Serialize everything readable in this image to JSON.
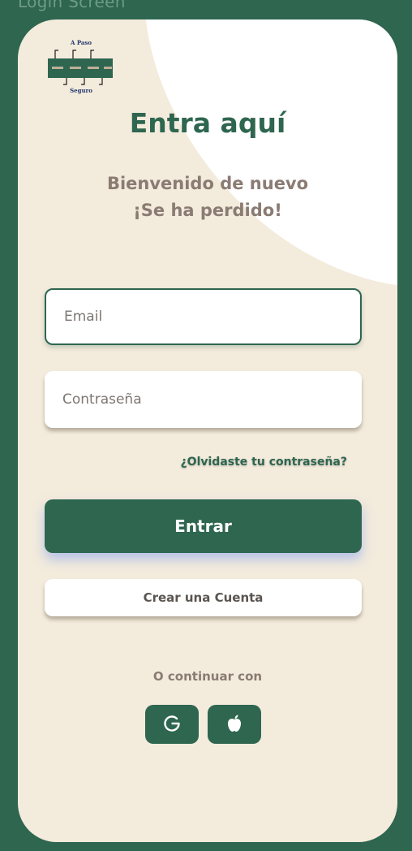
{
  "frame_label": "Login Screen",
  "logo": {
    "top_text": "A Paso",
    "bottom_text": "Seguro"
  },
  "title": "Entra aquí",
  "subtitle_line1": "Bienvenido de nuevo",
  "subtitle_line2": "¡Se ha perdido!",
  "email": {
    "placeholder": "Email",
    "value": ""
  },
  "password": {
    "placeholder": "Contraseña",
    "value": ""
  },
  "forgot_link": "¿Olvidaste tu contraseña?",
  "login_button": "Entrar",
  "create_account_button": "Crear una Cuenta",
  "or_continue": "O continuar con",
  "social": [
    {
      "icon": "google-icon"
    },
    {
      "icon": "apple-icon"
    }
  ],
  "colors": {
    "brand_green": "#2e6650",
    "background_cream": "#f3ebdc",
    "muted_text": "#8a7b73",
    "white": "#ffffff"
  }
}
